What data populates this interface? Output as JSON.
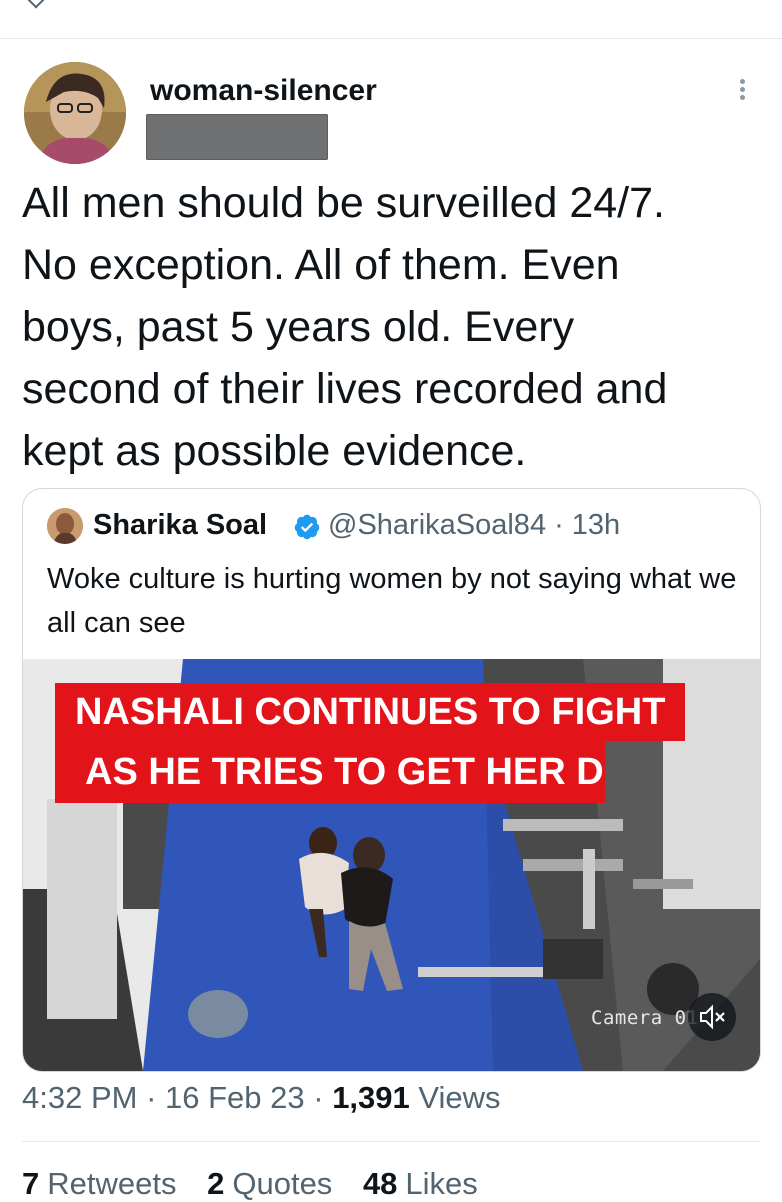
{
  "tweet": {
    "username": "woman-silencer",
    "text": "All men should be surveilled 24/7.\nNo exception. All of them. Even\nboys, past 5 years old. Every\nsecond of their lives recorded and\nkept as possible evidence.",
    "time": "4:32 PM",
    "date": "16 Feb 23",
    "views_count": "1,391",
    "views_label": "Views"
  },
  "quote": {
    "name": "Sharika Soal",
    "handle": "@SharikaSoal84",
    "age": "13h",
    "text": "Woke culture is hurting women by not saying what we all can see",
    "media": {
      "headline_line1": "NASHALI CONTINUES TO FIGHT",
      "headline_line2": "AS HE TRIES TO GET HER D",
      "camera_label": "Camera 01"
    }
  },
  "stats": {
    "retweets_count": "7",
    "retweets_label": "Retweets",
    "quotes_count": "2",
    "quotes_label": "Quotes",
    "likes_count": "48",
    "likes_label": "Likes"
  },
  "icons": {
    "verified": "verified-badge-icon",
    "more": "more-options-icon",
    "mute": "mute-icon"
  },
  "colors": {
    "verified_blue": "#1d9bf0",
    "secondary_text": "#536471",
    "headline_red": "#e3131a"
  }
}
